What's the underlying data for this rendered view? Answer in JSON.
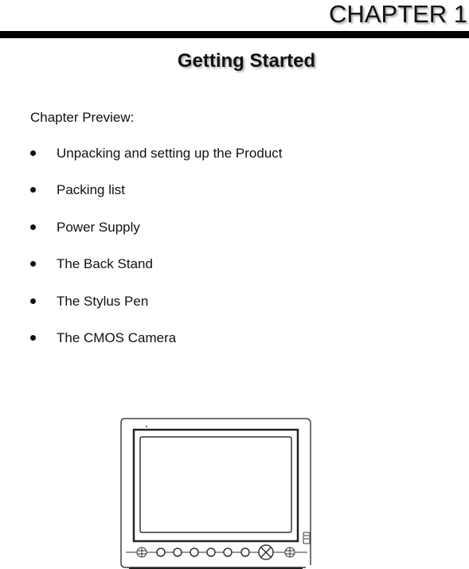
{
  "header": {
    "chapter_label": "CHAPTER 1"
  },
  "title": "Getting Started",
  "preview": {
    "label": "Chapter Preview:",
    "items": [
      {
        "text": "Unpacking and setting up the Product"
      },
      {
        "text": "Packing list"
      },
      {
        "text": "Power Supply"
      },
      {
        "text": "The Back Stand"
      },
      {
        "text": "The Stylus Pen"
      },
      {
        "text": "The CMOS Camera"
      }
    ]
  },
  "illustration": {
    "icon": "tablet-device-icon",
    "front_buttons": 7
  }
}
